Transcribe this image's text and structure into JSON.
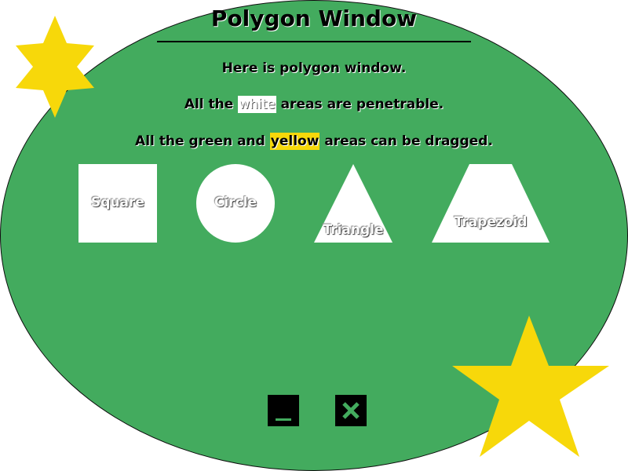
{
  "window": {
    "title": "Polygon Window",
    "messages": {
      "line1": "Here is polygon window.",
      "line2_prefix": "All the ",
      "line2_highlight": "white",
      "line2_suffix": " areas are penetrable.",
      "line3_prefix": "All the green and ",
      "line3_highlight": "yellow",
      "line3_suffix": " areas can be dragged."
    },
    "shapes": {
      "square": "Square",
      "circle": "Circle",
      "triangle": "Triangle",
      "trapezoid": "Trapezoid"
    },
    "controls": {
      "minimize_icon": "minimize-icon",
      "close_icon": "close-icon"
    }
  },
  "colors": {
    "window_green": "#43ab5e",
    "star_yellow": "#f7d80a",
    "highlight_yellow": "#f7d80a",
    "white": "#ffffff",
    "control_black": "#000000",
    "control_glyph": "#43ab5e"
  }
}
